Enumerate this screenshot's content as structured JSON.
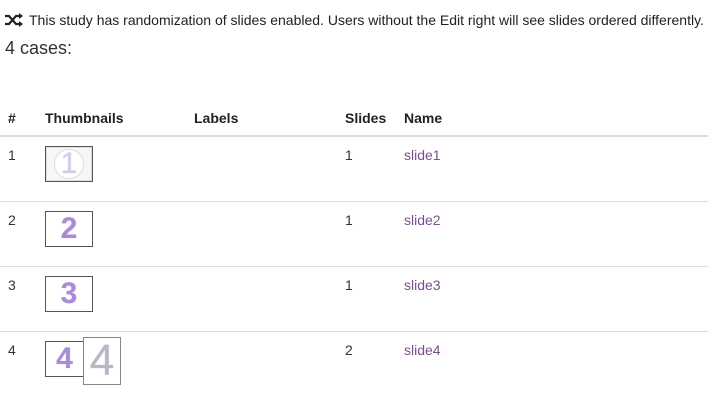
{
  "notice": {
    "icon": "shuffle-icon",
    "text": "This study has randomization of slides enabled. Users without the Edit right will see slides ordered differently."
  },
  "cases_count": "4 cases:",
  "table": {
    "headers": {
      "num": "#",
      "thumbnails": "Thumbnails",
      "labels": "Labels",
      "slides": "Slides",
      "name": "Name"
    },
    "rows": [
      {
        "num": "1",
        "thumbs": [
          "1"
        ],
        "labels": "",
        "slides": "1",
        "name": "slide1"
      },
      {
        "num": "2",
        "thumbs": [
          "2"
        ],
        "labels": "",
        "slides": "1",
        "name": "slide2"
      },
      {
        "num": "3",
        "thumbs": [
          "3"
        ],
        "labels": "",
        "slides": "1",
        "name": "slide3"
      },
      {
        "num": "4",
        "thumbs": [
          "4",
          "4"
        ],
        "labels": "",
        "slides": "2",
        "name": "slide4"
      }
    ]
  },
  "colors": {
    "link": "#7c4e8c",
    "thumb_digit": "#a98bd6",
    "divider": "#dddddd"
  }
}
